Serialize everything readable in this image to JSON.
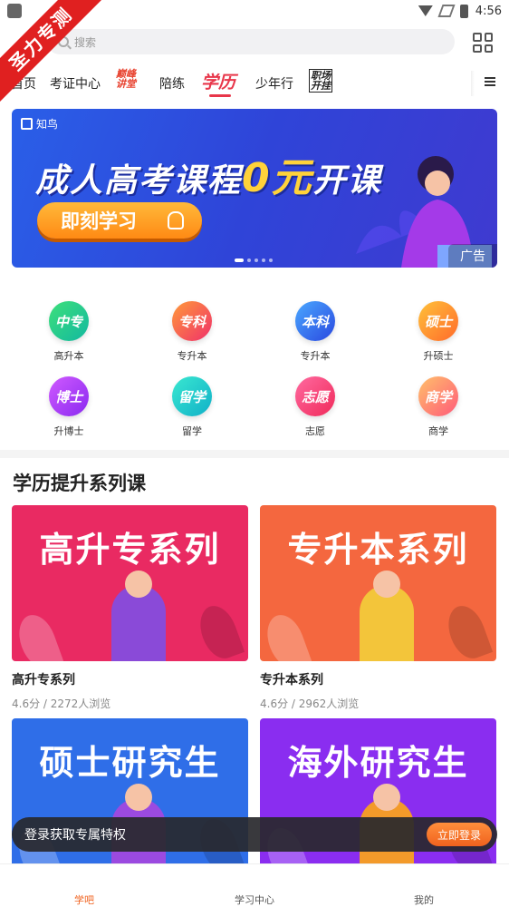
{
  "status_bar": {
    "time": "4:56"
  },
  "ribbon": {
    "text": "圣力专测"
  },
  "search": {
    "placeholder": "搜索"
  },
  "tabs": {
    "items": [
      "首页",
      "考证中心",
      "陪练",
      "学历",
      "少年行"
    ],
    "badge_left": "巅峰\n讲堂",
    "badge_right": "职场\n开挂",
    "active": "学历"
  },
  "banner": {
    "logo": "知鸟",
    "headline_pre": "成人高考课程",
    "headline_zero": "0元",
    "headline_post": "开课",
    "cta": "即刻学习",
    "ad_label": "广告"
  },
  "categories": [
    {
      "icon_text": "中专",
      "label": "高升本",
      "color_a": "#3ee07a",
      "color_b": "#12b8a0"
    },
    {
      "icon_text": "专科",
      "label": "专升本",
      "color_a": "#ff9a3a",
      "color_b": "#f0306a"
    },
    {
      "icon_text": "本科",
      "label": "专升本",
      "color_a": "#4aa8ff",
      "color_b": "#2a48e0"
    },
    {
      "icon_text": "硕士",
      "label": "升硕士",
      "color_a": "#ffc23a",
      "color_b": "#ff6a2a"
    },
    {
      "icon_text": "博士",
      "label": "升博士",
      "color_a": "#d05aff",
      "color_b": "#8a2af0"
    },
    {
      "icon_text": "留学",
      "label": "留学",
      "color_a": "#3ae8d0",
      "color_b": "#10b0c8"
    },
    {
      "icon_text": "志愿",
      "label": "志愿",
      "color_a": "#ff6aa0",
      "color_b": "#f02a5a"
    },
    {
      "icon_text": "商学",
      "label": "商学",
      "color_a": "#ffc06a",
      "color_b": "#ff5a7a"
    }
  ],
  "section": {
    "title": "学历提升系列课"
  },
  "courses": [
    {
      "image_text": "高升专系列",
      "title": "高升专系列",
      "meta": "4.6分 / 2272人浏览",
      "bg": "#e92a62",
      "accent": "#8a4ad8"
    },
    {
      "image_text": "专升本系列",
      "title": "专升本系列",
      "meta": "4.6分 / 2962人浏览",
      "bg": "#f4673f",
      "accent": "#f3c53a"
    },
    {
      "image_text": "硕士研究生",
      "title": "",
      "meta": "",
      "bg": "#2f6ee8",
      "accent": "#9b4ae0"
    },
    {
      "image_text": "海外研究生",
      "title": "",
      "meta": "",
      "bg": "#8a2df0",
      "accent": "#f39a2a"
    }
  ],
  "login_toast": {
    "text": "登录获取专属特权",
    "button": "立即登录"
  },
  "bottom_nav": {
    "items": [
      "学吧",
      "学习中心",
      "我的"
    ],
    "active": "学吧"
  },
  "colors": {
    "accent": "#f0621e",
    "active_tab": "#e8364a"
  }
}
